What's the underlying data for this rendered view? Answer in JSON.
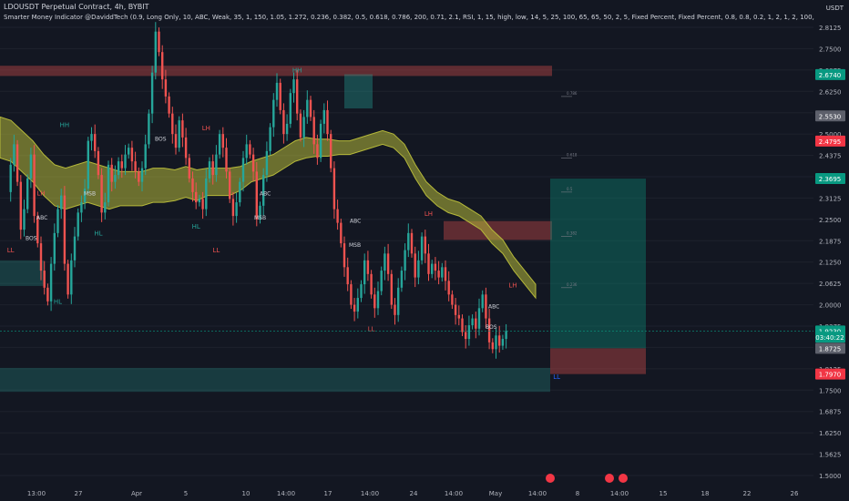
{
  "header": {
    "symbol_line": "LDOUSDT Perpetual Contract, 4h, BYBIT",
    "indicator_line": "Smarter Money Indicator @DaviddTech (0.9, Long Only, 10, ABC, Weak, 35, 1, 150, 1.05, 1.272, 0.236, 0.382, 0.5, 0.618, 0.786, 200, 0.71, 2.1, RSI, 1, 15, high, low, 14, 5, 25, 100, 65, 65, 50, 2, 5, Fixed Percent, Fixed Percent, 0.8, 0.8, 0.2, 1, 2, 1, 2, 100, 200, 100, 200, 50, 60, 2, 2, 1, Source, close, close",
    "currency": "USDT"
  },
  "colors": {
    "background": "#131722",
    "up": "#26a69a",
    "down": "#ef5350",
    "grid": "#1e222d",
    "axis_text": "#b2b5be",
    "band": "#b5b83a",
    "tag_current": "#089981",
    "tag_red": "#f23645",
    "tag_gray": "#5d606b"
  },
  "chart_data": {
    "type": "candlestick",
    "ylim": [
      1.5,
      2.825
    ],
    "y_ticks": [
      "2.8125",
      "2.7500",
      "2.6875",
      "2.6250",
      "2.5625",
      "2.5000",
      "2.4375",
      "2.3750",
      "2.3125",
      "2.2500",
      "2.1875",
      "2.1250",
      "2.0625",
      "2.0000",
      "1.9375",
      "1.8750",
      "1.8125",
      "1.7500",
      "1.6875",
      "1.6250",
      "1.5625",
      "1.5000"
    ],
    "x_ticks": [
      "13:00",
      "27",
      "Apr",
      "5",
      "10",
      "14:00",
      "17",
      "14:00",
      "24",
      "14:00",
      "May",
      "14:00",
      "8",
      "14:00",
      "15",
      "18",
      "22",
      "26"
    ],
    "price_tags": [
      {
        "label": "2.6740",
        "value": 2.674,
        "kind": "current"
      },
      {
        "label": "2.5530",
        "value": 2.553,
        "kind": "gray"
      },
      {
        "label": "2.4795",
        "value": 2.4795,
        "kind": "red"
      },
      {
        "label": "2.3695",
        "value": 2.3695,
        "kind": "current"
      },
      {
        "label": "1.9230",
        "value": 1.923,
        "kind": "current"
      },
      {
        "label": "03:40:22",
        "value": 1.905,
        "kind": "current"
      },
      {
        "label": "1.8725",
        "value": 1.8725,
        "kind": "gray"
      },
      {
        "label": "1.7970",
        "value": 1.797,
        "kind": "red"
      }
    ],
    "close_path": [
      2.33,
      2.41,
      2.47,
      2.36,
      2.22,
      2.28,
      2.37,
      2.44,
      2.26,
      2.18,
      2.1,
      2.05,
      2.01,
      2.12,
      2.21,
      2.28,
      2.32,
      2.12,
      2.03,
      2.13,
      2.2,
      2.27,
      2.3,
      2.34,
      2.48,
      2.5,
      2.45,
      2.38,
      2.27,
      2.3,
      2.41,
      2.36,
      2.38,
      2.42,
      2.4,
      2.44,
      2.46,
      2.42,
      2.39,
      2.36,
      2.4,
      2.47,
      2.56,
      2.68,
      2.8,
      2.74,
      2.66,
      2.61,
      2.56,
      2.5,
      2.46,
      2.54,
      2.49,
      2.43,
      2.37,
      2.33,
      2.3,
      2.31,
      2.28,
      2.37,
      2.42,
      2.38,
      2.44,
      2.5,
      2.46,
      2.39,
      2.31,
      2.26,
      2.3,
      2.36,
      2.43,
      2.47,
      2.44,
      2.39,
      2.25,
      2.29,
      2.38,
      2.45,
      2.52,
      2.6,
      2.65,
      2.57,
      2.5,
      2.53,
      2.62,
      2.66,
      2.56,
      2.49,
      2.55,
      2.6,
      2.55,
      2.47,
      2.43,
      2.53,
      2.57,
      2.5,
      2.4,
      2.28,
      2.24,
      2.18,
      2.11,
      2.06,
      2.0,
      1.98,
      2.02,
      2.06,
      2.13,
      2.09,
      2.03,
      1.99,
      2.04,
      2.1,
      2.15,
      2.09,
      2.0,
      1.97,
      2.05,
      2.1,
      2.16,
      2.21,
      2.15,
      2.08,
      2.13,
      2.2,
      2.15,
      2.09,
      2.12,
      2.1,
      2.08,
      2.11,
      2.07,
      2.03,
      2.0,
      1.97,
      1.96,
      1.92,
      1.9,
      1.94,
      1.96,
      1.93,
      1.99,
      2.03,
      1.96,
      1.89,
      1.87,
      1.91,
      1.88,
      1.9,
      1.923
    ],
    "indicator_band": {
      "center": [
        2.49,
        2.48,
        2.45,
        2.42,
        2.38,
        2.35,
        2.34,
        2.35,
        2.36,
        2.35,
        2.34,
        2.34,
        2.34,
        2.34,
        2.35,
        2.35,
        2.35,
        2.36,
        2.35,
        2.36,
        2.36,
        2.36,
        2.37,
        2.39,
        2.4,
        2.41,
        2.43,
        2.45,
        2.46,
        2.46,
        2.46,
        2.46,
        2.46,
        2.47,
        2.48,
        2.49,
        2.48,
        2.45,
        2.39,
        2.34,
        2.31,
        2.29,
        2.28,
        2.26,
        2.24,
        2.2,
        2.17,
        2.12,
        2.08,
        2.04
      ],
      "half_width": [
        0.06,
        0.06,
        0.06,
        0.06,
        0.06,
        0.06,
        0.06,
        0.06,
        0.06,
        0.06,
        0.06,
        0.05,
        0.05,
        0.05,
        0.05,
        0.05,
        0.045,
        0.045,
        0.045,
        0.04,
        0.04,
        0.04,
        0.035,
        0.03,
        0.03,
        0.03,
        0.03,
        0.03,
        0.03,
        0.025,
        0.025,
        0.02,
        0.02,
        0.02,
        0.02,
        0.02,
        0.02,
        0.02,
        0.02,
        0.02,
        0.02,
        0.02,
        0.02,
        0.02,
        0.02,
        0.02,
        0.02,
        0.02,
        0.02,
        0.02
      ]
    },
    "structure_labels": [
      {
        "text": "HH",
        "i": 17,
        "price": 2.51,
        "above": true,
        "color": "#26a69a"
      },
      {
        "text": "LH",
        "i": 10,
        "price": 2.31,
        "above": true,
        "color": "#ef5350"
      },
      {
        "text": "LL",
        "i": 1,
        "price": 2.18,
        "above": false,
        "color": "#ef5350"
      },
      {
        "text": "HL",
        "i": 15,
        "price": 2.03,
        "above": false,
        "color": "#26a69a"
      },
      {
        "text": "HL",
        "i": 27,
        "price": 2.23,
        "above": false,
        "color": "#26a69a"
      },
      {
        "text": "LH",
        "i": 59,
        "price": 2.5,
        "above": true,
        "color": "#ef5350"
      },
      {
        "text": "HL",
        "i": 56,
        "price": 2.25,
        "above": false,
        "color": "#26a69a"
      },
      {
        "text": "HH",
        "i": 86,
        "price": 2.67,
        "above": true,
        "color": "#26a69a"
      },
      {
        "text": "LL",
        "i": 62,
        "price": 2.18,
        "above": false,
        "color": "#ef5350"
      },
      {
        "text": "LH",
        "i": 125,
        "price": 2.25,
        "above": true,
        "color": "#ef5350"
      },
      {
        "text": "LL",
        "i": 108,
        "price": 1.95,
        "above": false,
        "color": "#ef5350"
      },
      {
        "text": "LH",
        "i": 150,
        "price": 2.04,
        "above": true,
        "color": "#ef5350"
      },
      {
        "text": "LL",
        "i": 163,
        "price": 1.81,
        "above": false,
        "color": "#2962ff"
      }
    ],
    "annotations": [
      "BOS",
      "MSB",
      "BOS",
      "MSB",
      "MSB",
      "BOS",
      "ABC",
      "ABC",
      "ABC",
      "ABC"
    ],
    "fib_levels": [
      "0.786",
      "0.618",
      "0.5",
      "0.382",
      "0.236"
    ]
  },
  "footer": {
    "event_icon": "calendar-event-icon"
  }
}
